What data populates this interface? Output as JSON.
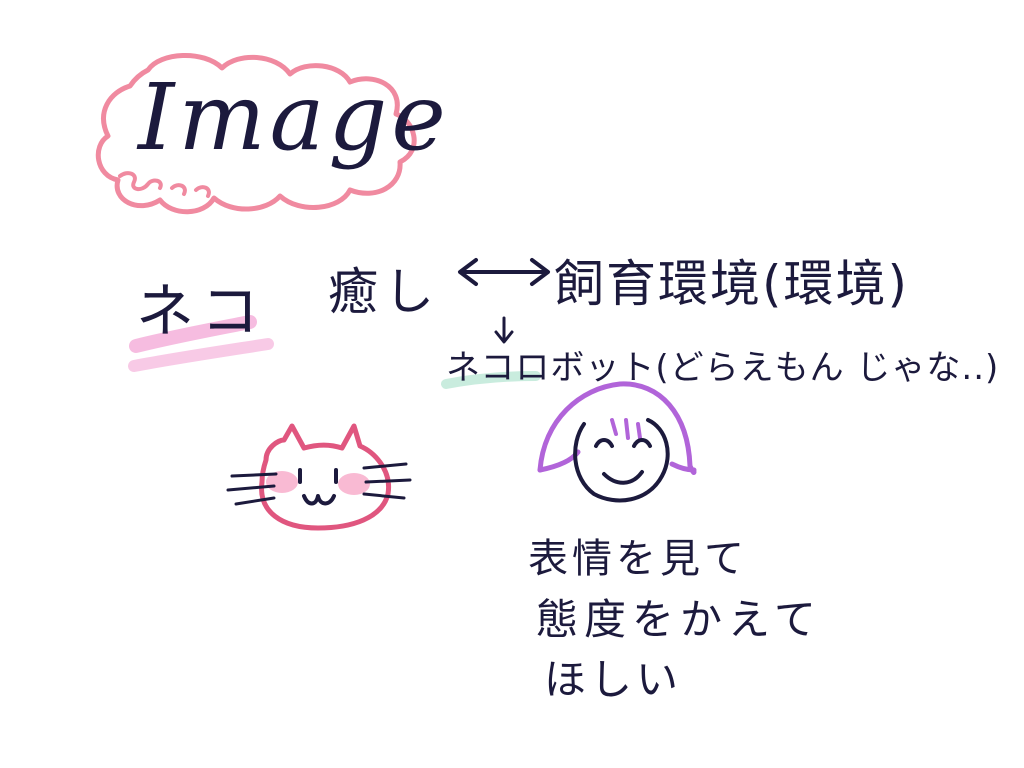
{
  "title": "Image",
  "keyword": "ネコ",
  "relation": {
    "left": "癒し",
    "right": "飼育環境(環境)",
    "arrow": "double-arrow-icon"
  },
  "robot_line": "ネコロボット(どらえもん じゃな..)",
  "face_note": {
    "line1": "表情を見て",
    "line2": "態度をかえて",
    "line3": "ほしい"
  },
  "colors": {
    "ink": "#1c1a3d",
    "cloud": "#f08aa0",
    "highlight_pink": "#f3a6d6",
    "highlight_mint": "#bfe9d8",
    "cat": "#e0567f",
    "cheek": "#f7a9c8",
    "hair": "#b164d9"
  }
}
